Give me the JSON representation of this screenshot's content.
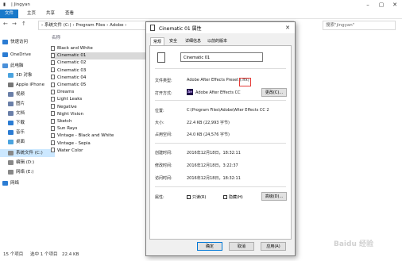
{
  "explorer": {
    "title": "| Jingyan",
    "ribbon_tabs": [
      "文件",
      "主页",
      "共享",
      "查看"
    ],
    "address": "› 系统文件 (C:) › Program Files › Adobe ›",
    "search_placeholder": "搜索\"jingyan\"",
    "column_header": "名称",
    "sidebar": [
      {
        "label": "快速访问",
        "color": "#2b7cd3"
      },
      {
        "label": "OneDrive",
        "color": "#2b7cd3"
      },
      {
        "label": "此电脑",
        "color": "#4a90d9"
      },
      {
        "label": "3D 对象",
        "color": "#4aa3df"
      },
      {
        "label": "Apple iPhone",
        "color": "#777777"
      },
      {
        "label": "视频",
        "color": "#6a7fa8"
      },
      {
        "label": "图片",
        "color": "#6a7fa8"
      },
      {
        "label": "文档",
        "color": "#6a7fa8"
      },
      {
        "label": "下载",
        "color": "#2b7cd3"
      },
      {
        "label": "音乐",
        "color": "#2b7cd3"
      },
      {
        "label": "桌面",
        "color": "#4aa3df"
      },
      {
        "label": "系统文件 (C:)",
        "color": "#888888"
      },
      {
        "label": "编辑 (D:)",
        "color": "#888888"
      },
      {
        "label": "网络 (E:)",
        "color": "#888888"
      },
      {
        "label": "网络",
        "color": "#2b7cd3"
      }
    ],
    "files": [
      "Black and White",
      "Cinematic 01",
      "Cinematic 02",
      "Cinematic 03",
      "Cinematic 04",
      "Cinematic 05",
      "Dreams",
      "Light Leaks",
      "Negative",
      "Night Vision",
      "Sketch",
      "Sun Rays",
      "Vintage - Black and White",
      "Vintage - Sepia",
      "Water Color"
    ],
    "status": {
      "count": "15 个项目",
      "selected": "选中 1 个项目",
      "size": "22.4 KB"
    }
  },
  "dialog": {
    "title": "Cinematic 01 属性",
    "tabs": [
      "常规",
      "安全",
      "详细信息",
      "以前的版本"
    ],
    "filename": "Cinematic 01",
    "labels": {
      "type": "文件类型:",
      "open_with": "打开方式:",
      "location": "位置:",
      "size": "大小:",
      "size_on_disk": "占用空间:",
      "created": "创建时间:",
      "modified": "修改时间:",
      "accessed": "访问时间:",
      "attributes": "属性:"
    },
    "values": {
      "type": "Adobe After Effects Preset (.ffx)",
      "open_with": "Adobe After Effects CC",
      "location": "C:\\Program Files\\Adobe\\After Effects CC 2",
      "size": "22.4 KB (22,993 字节)",
      "size_on_disk": "24.0 KB (24,576 字节)",
      "created": "2016年12月18日，18:32:11",
      "modified": "2016年12月18日，3:22:37",
      "accessed": "2016年12月18日，18:32:11"
    },
    "app_icon": "Ae",
    "change_button": "更改(C)...",
    "readonly": "只读(R)",
    "hidden": "隐藏(H)",
    "advanced_button": "高级(D)...",
    "ok": "确定",
    "cancel": "取消",
    "apply": "应用(A)"
  },
  "watermark": "Baidu 经验"
}
